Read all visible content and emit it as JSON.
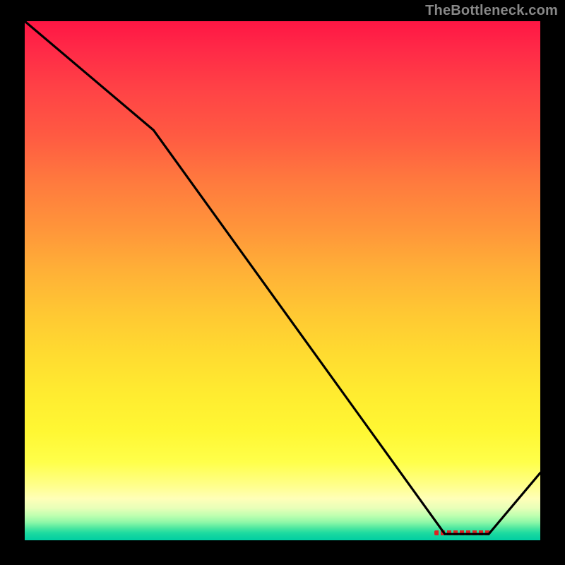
{
  "watermark": "TheBottleneck.com",
  "chart_data": {
    "type": "line",
    "title": "",
    "xlabel": "",
    "ylabel": "",
    "xlim": [
      0,
      100
    ],
    "ylim": [
      0,
      100
    ],
    "grid": false,
    "legend": false,
    "background_gradient": {
      "top": "#ff1644",
      "mid": "#ffe030",
      "bottom": "#00cfa2"
    },
    "series": [
      {
        "name": "bottleneck-curve",
        "color": "#000000",
        "x": [
          0,
          25,
          81.5,
          90,
          100
        ],
        "values": [
          100,
          79,
          1.2,
          1.2,
          13
        ]
      }
    ],
    "marker": {
      "name": "optimal-range",
      "color": "#d22222",
      "x_range": [
        79.5,
        90.5
      ],
      "y": 1.5
    }
  }
}
